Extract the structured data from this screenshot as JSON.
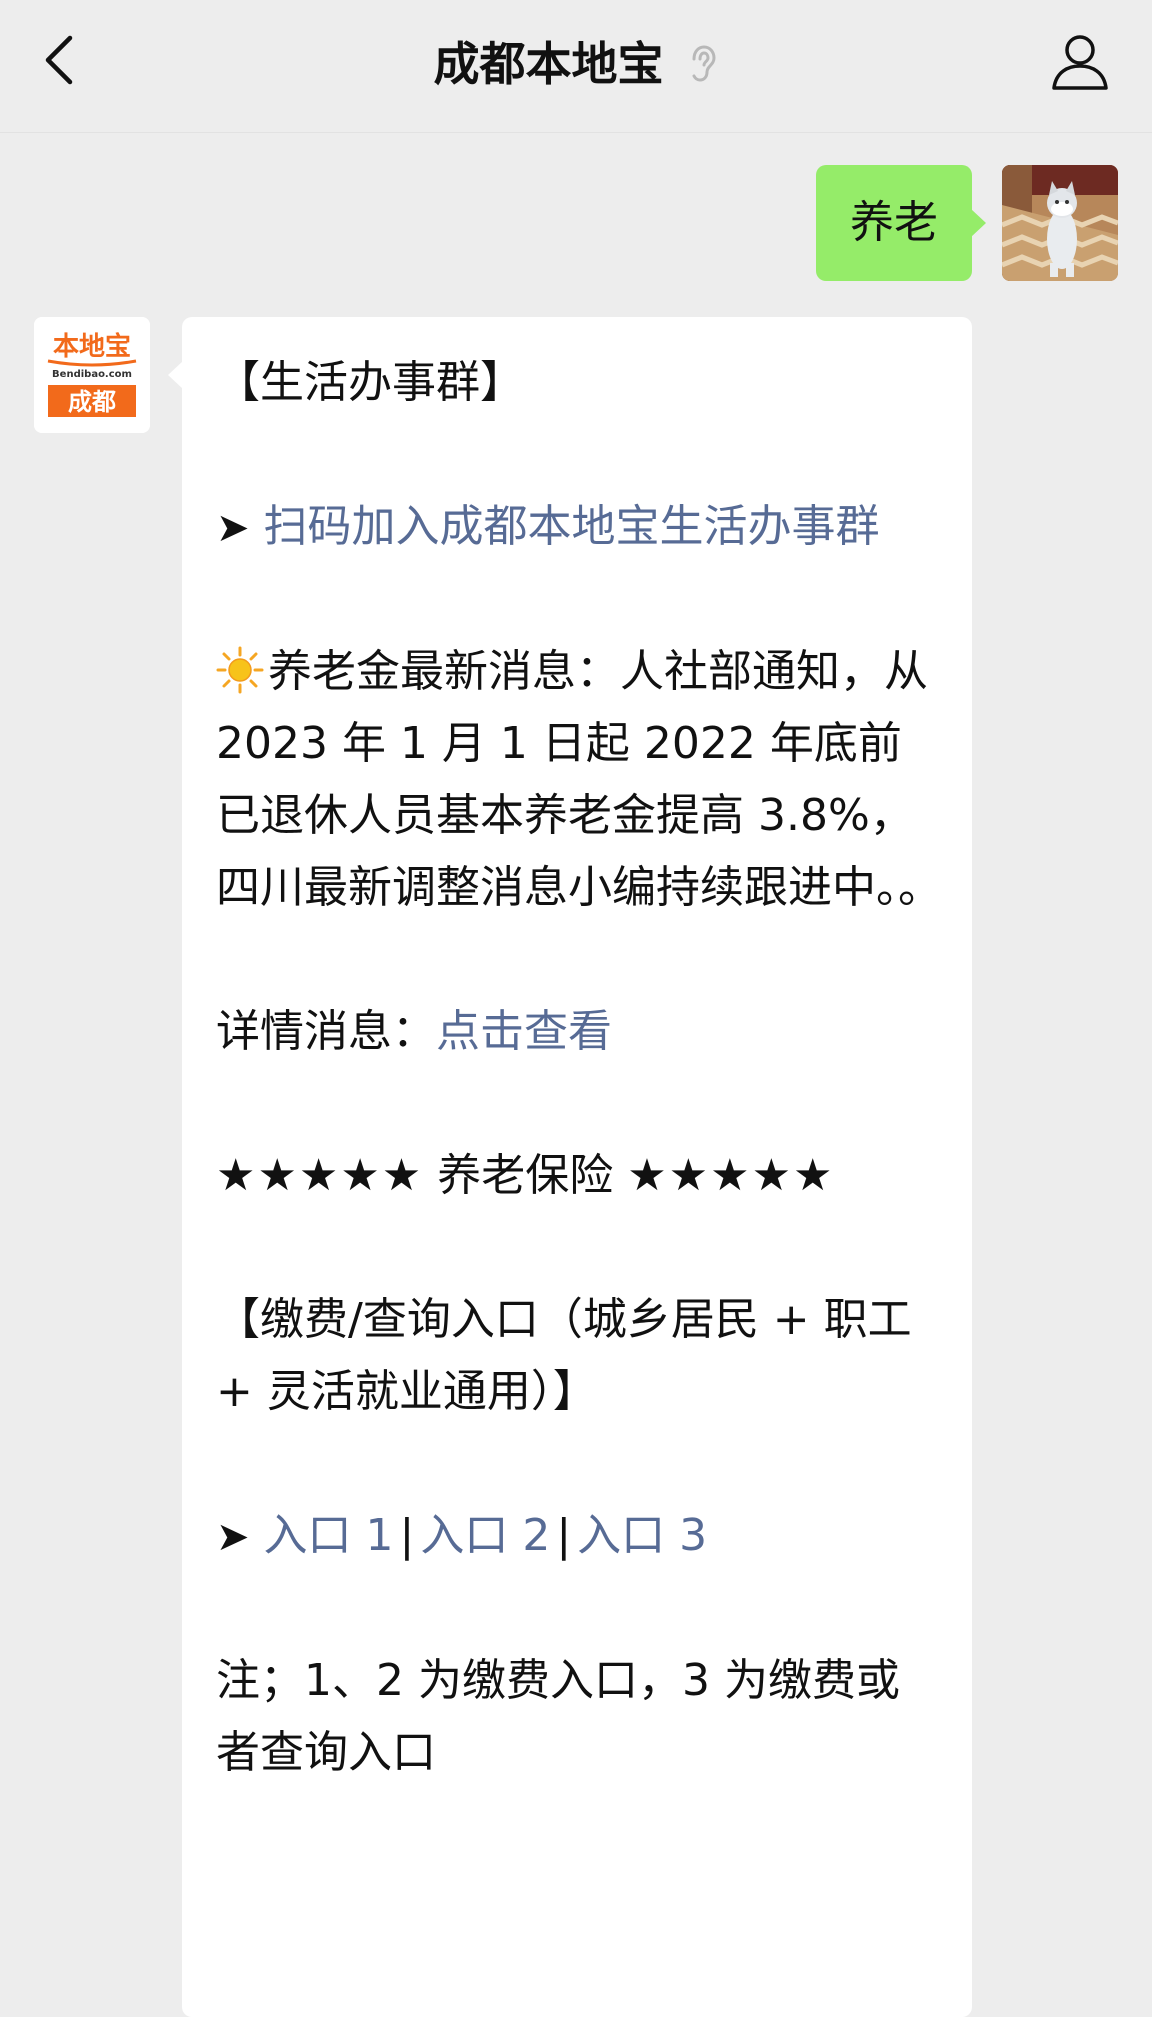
{
  "header": {
    "title": "成都本地宝"
  },
  "outgoing": {
    "text": "养老"
  },
  "incoming": {
    "avatar": {
      "brand": "本地宝",
      "domain": "Bendibao.com",
      "city": "成都"
    },
    "group_title": "【生活办事群】",
    "scan_arrow": "➤",
    "scan_link": "扫码加入成都本地宝生活办事群",
    "news_text": "养老金最新消息：人社部通知，从 2023 年 1 月 1 日起 2022 年底前已退休人员基本养老金提高 3.8%，四川最新调整消息小编持续跟进中。。",
    "detail_label": "详情消息：",
    "detail_link": "点击查看",
    "stars_left": "★★★★★",
    "section_title": "养老保险",
    "stars_right": "★★★★★",
    "entry_title": "【缴费/查询入口（城乡居民 + 职工 + 灵活就业通用）】",
    "entry_arrow": "➤",
    "entry_link_1": "入口 1",
    "entry_sep_1": "|",
    "entry_link_2": "入口 2",
    "entry_sep_2": "|",
    "entry_link_3": "入口 3",
    "note": "注；1、2 为缴费入口，3 为缴费或者查询入口"
  },
  "colors": {
    "background": "#ededed",
    "outgoing_bubble": "#95ec69",
    "incoming_bubble": "#ffffff",
    "link": "#576b95",
    "brand_orange": "#f26a1b"
  },
  "icons": [
    "back-arrow-icon",
    "ear-icon",
    "profile-icon",
    "sun-icon"
  ]
}
